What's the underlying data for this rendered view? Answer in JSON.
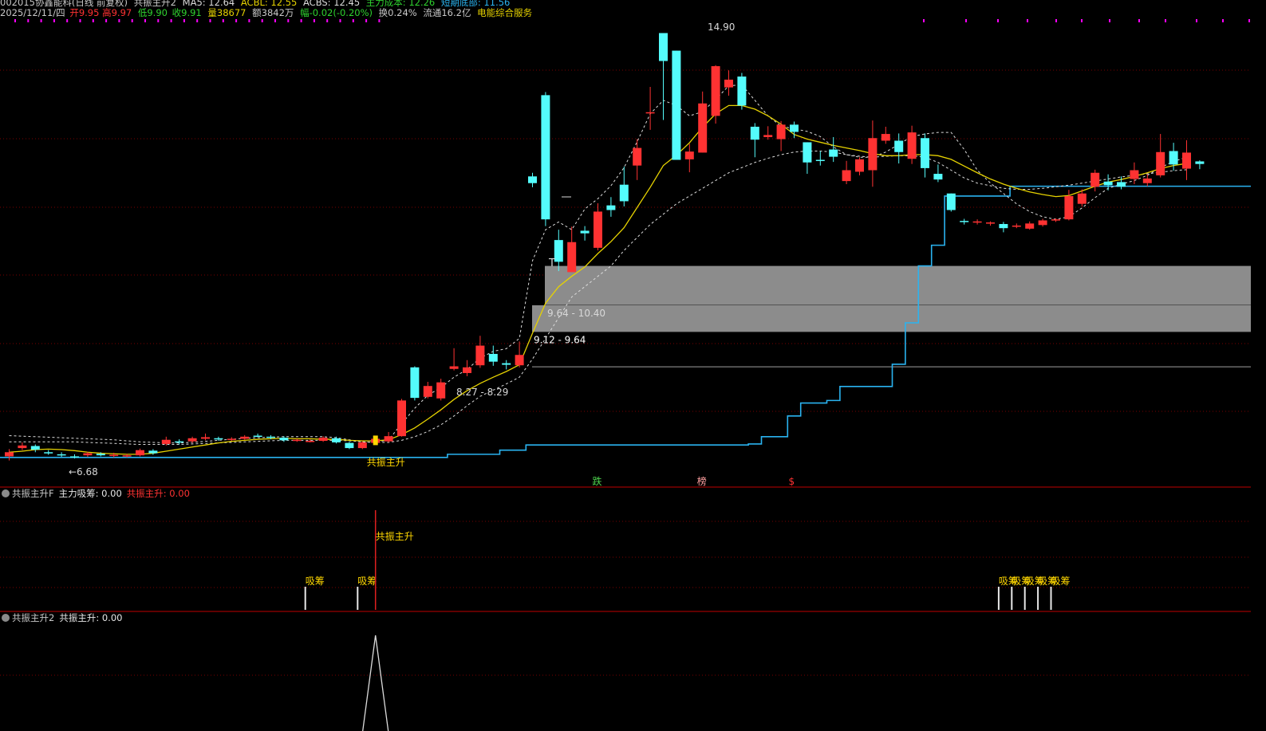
{
  "header": {
    "code_name": "002015协鑫能科(日线 前复权)",
    "indicator_name": "共振主升2",
    "ma5": "MA5: 12.64",
    "acbl": "ACBL: 12.55",
    "acbs": "ACBS: 12.45",
    "main_cost": "主力成本: 12.26",
    "short_bottom": "短期底部: 11.56",
    "date": "2025/12/11/四",
    "open": "开9.95",
    "high": "高9.97",
    "low": "低9.90",
    "close": "收9.91",
    "volume": "量38677",
    "amount": "额3842万",
    "change": "幅-0.02(-0.20%)",
    "turnover": "换0.24%",
    "float": "流通16.2亿",
    "sector": "电能综合服务"
  },
  "indicators": [
    {
      "circle_icon": "collapse-icon",
      "name": "共振主升F",
      "label1": "主力吸筹: 0.00",
      "label2": "共振主升: 0.00"
    },
    {
      "circle_icon": "collapse-icon",
      "name": "共振主升2",
      "label1": "共振主升: 0.00"
    }
  ],
  "colors": {
    "up": "#ff3232",
    "down": "#54fcfc",
    "ma_yellow": "#e6d200",
    "dash_white": "#dcdcdc",
    "cost_blue": "#2ab3f0",
    "grid": "#7a0000",
    "zone": "#8c8c8c",
    "signal_yellow": "#ffd700"
  },
  "chart_data": {
    "type": "candlestick",
    "title": "",
    "price_labels": {
      "high": "14.90",
      "low": "←6.68"
    },
    "zones": [
      {
        "low": 9.64,
        "high": 10.4,
        "label": "9.64 - 10.40"
      },
      {
        "low": 9.12,
        "high": 9.64,
        "label": "9.12 - 9.64"
      }
    ],
    "range_labels": [
      {
        "label": "8.27 - 8.29",
        "price": 8.28,
        "index": 35
      }
    ],
    "ref_line": 8.45,
    "y_range": [
      6.45,
      15.2
    ],
    "candles": [
      {
        "o": 6.72,
        "c": 6.8,
        "h": 6.86,
        "l": 6.64
      },
      {
        "o": 6.88,
        "c": 6.93,
        "h": 6.99,
        "l": 6.84
      },
      {
        "o": 6.92,
        "c": 6.85,
        "h": 6.95,
        "l": 6.8
      },
      {
        "o": 6.8,
        "c": 6.79,
        "h": 6.84,
        "l": 6.75
      },
      {
        "o": 6.76,
        "c": 6.74,
        "h": 6.8,
        "l": 6.71
      },
      {
        "o": 6.72,
        "c": 6.7,
        "h": 6.76,
        "l": 6.68
      },
      {
        "o": 6.74,
        "c": 6.78,
        "h": 6.81,
        "l": 6.71
      },
      {
        "o": 6.77,
        "c": 6.74,
        "h": 6.8,
        "l": 6.72
      },
      {
        "o": 6.75,
        "c": 6.75,
        "h": 6.79,
        "l": 6.7
      },
      {
        "o": 6.73,
        "c": 6.74,
        "h": 6.77,
        "l": 6.7
      },
      {
        "o": 6.74,
        "c": 6.84,
        "h": 6.87,
        "l": 6.72
      },
      {
        "o": 6.83,
        "c": 6.78,
        "h": 6.86,
        "l": 6.75
      },
      {
        "o": 6.96,
        "c": 7.04,
        "h": 7.1,
        "l": 6.93
      },
      {
        "o": 7.01,
        "c": 6.99,
        "h": 7.05,
        "l": 6.95
      },
      {
        "o": 7.01,
        "c": 7.07,
        "h": 7.1,
        "l": 6.98
      },
      {
        "o": 7.06,
        "c": 7.09,
        "h": 7.16,
        "l": 7.03
      },
      {
        "o": 7.07,
        "c": 7.06,
        "h": 7.1,
        "l": 7.02
      },
      {
        "o": 7.05,
        "c": 7.06,
        "h": 7.09,
        "l": 7.02
      },
      {
        "o": 7.06,
        "c": 7.1,
        "h": 7.13,
        "l": 7.04
      },
      {
        "o": 7.12,
        "c": 7.11,
        "h": 7.16,
        "l": 7.09
      },
      {
        "o": 7.1,
        "c": 7.09,
        "h": 7.13,
        "l": 7.05
      },
      {
        "o": 7.08,
        "c": 7.03,
        "h": 7.11,
        "l": 7.0
      },
      {
        "o": 7.02,
        "c": 7.04,
        "h": 7.06,
        "l": 7.0
      },
      {
        "o": 7.02,
        "c": 7.02,
        "h": 7.05,
        "l": 6.99
      },
      {
        "o": 7.02,
        "c": 7.08,
        "h": 7.11,
        "l": 7.0
      },
      {
        "o": 7.07,
        "c": 6.99,
        "h": 7.1,
        "l": 6.97
      },
      {
        "o": 6.98,
        "c": 6.88,
        "h": 7.0,
        "l": 6.86
      },
      {
        "o": 6.88,
        "c": 6.99,
        "h": 7.01,
        "l": 6.86
      },
      {
        "o": 6.98,
        "c": 7.06,
        "h": 7.09,
        "l": 6.95
      },
      {
        "o": 7.01,
        "c": 7.11,
        "h": 7.19,
        "l": 6.99
      },
      {
        "o": 7.11,
        "c": 7.8,
        "h": 7.83,
        "l": 7.1
      },
      {
        "o": 8.44,
        "c": 7.85,
        "h": 8.46,
        "l": 7.8
      },
      {
        "o": 7.87,
        "c": 8.08,
        "h": 8.16,
        "l": 7.84
      },
      {
        "o": 7.84,
        "c": 8.15,
        "h": 8.22,
        "l": 7.8
      },
      {
        "o": 8.41,
        "c": 8.46,
        "h": 8.81,
        "l": 8.38
      },
      {
        "o": 8.33,
        "c": 8.44,
        "h": 8.58,
        "l": 8.27
      },
      {
        "o": 8.48,
        "c": 8.86,
        "h": 9.05,
        "l": 8.43
      },
      {
        "o": 8.7,
        "c": 8.55,
        "h": 8.86,
        "l": 8.47
      },
      {
        "o": 8.52,
        "c": 8.49,
        "h": 8.58,
        "l": 8.4
      },
      {
        "o": 8.48,
        "c": 8.68,
        "h": 8.94,
        "l": 8.44
      },
      {
        "o": 12.13,
        "c": 12.0,
        "h": 12.2,
        "l": 11.92
      },
      {
        "o": 13.7,
        "c": 11.3,
        "h": 13.76,
        "l": 11.17
      },
      {
        "o": 10.9,
        "c": 10.48,
        "h": 11.1,
        "l": 10.3
      },
      {
        "o": 10.28,
        "c": 10.86,
        "h": 11.16,
        "l": 10.28
      },
      {
        "o": 11.08,
        "c": 11.03,
        "h": 11.17,
        "l": 10.89
      },
      {
        "o": 10.75,
        "c": 11.45,
        "h": 11.61,
        "l": 10.7
      },
      {
        "o": 11.57,
        "c": 11.48,
        "h": 11.73,
        "l": 11.35
      },
      {
        "o": 11.97,
        "c": 11.65,
        "h": 12.32,
        "l": 11.55
      },
      {
        "o": 12.34,
        "c": 12.68,
        "h": 12.85,
        "l": 12.06
      },
      {
        "o": 13.37,
        "c": 13.37,
        "h": 13.86,
        "l": 13.03
      },
      {
        "o": 14.9,
        "c": 14.36,
        "h": 14.9,
        "l": 13.22
      },
      {
        "o": 14.56,
        "c": 12.45,
        "h": 14.56,
        "l": 12.45
      },
      {
        "o": 12.46,
        "c": 12.61,
        "h": 12.76,
        "l": 12.21
      },
      {
        "o": 12.59,
        "c": 13.54,
        "h": 13.77,
        "l": 12.59
      },
      {
        "o": 13.3,
        "c": 14.26,
        "h": 14.28,
        "l": 13.15
      },
      {
        "o": 13.85,
        "c": 14.0,
        "h": 14.18,
        "l": 13.69
      },
      {
        "o": 14.06,
        "c": 13.5,
        "h": 14.13,
        "l": 13.42
      },
      {
        "o": 13.09,
        "c": 12.84,
        "h": 13.16,
        "l": 12.5
      },
      {
        "o": 12.89,
        "c": 12.93,
        "h": 13.1,
        "l": 12.84
      },
      {
        "o": 12.85,
        "c": 13.13,
        "h": 13.2,
        "l": 12.62
      },
      {
        "o": 13.13,
        "c": 12.99,
        "h": 13.19,
        "l": 12.87
      },
      {
        "o": 12.79,
        "c": 12.4,
        "h": 12.79,
        "l": 12.18
      },
      {
        "o": 12.45,
        "c": 12.43,
        "h": 12.62,
        "l": 12.34
      },
      {
        "o": 12.65,
        "c": 12.51,
        "h": 12.89,
        "l": 12.41
      },
      {
        "o": 12.04,
        "c": 12.25,
        "h": 12.43,
        "l": 11.98
      },
      {
        "o": 12.22,
        "c": 12.46,
        "h": 12.5,
        "l": 12.15
      },
      {
        "o": 12.25,
        "c": 12.87,
        "h": 13.21,
        "l": 11.93
      },
      {
        "o": 12.82,
        "c": 12.95,
        "h": 13.09,
        "l": 12.76
      },
      {
        "o": 12.82,
        "c": 12.6,
        "h": 12.96,
        "l": 12.38
      },
      {
        "o": 12.47,
        "c": 12.98,
        "h": 13.11,
        "l": 12.37
      },
      {
        "o": 12.87,
        "c": 12.29,
        "h": 12.96,
        "l": 12.11
      },
      {
        "o": 12.18,
        "c": 12.07,
        "h": 12.36,
        "l": 12.02
      },
      {
        "o": 11.8,
        "c": 11.48,
        "h": 11.8,
        "l": 11.45
      },
      {
        "o": 11.27,
        "c": 11.26,
        "h": 11.31,
        "l": 11.2
      },
      {
        "o": 11.25,
        "c": 11.26,
        "h": 11.3,
        "l": 11.2
      },
      {
        "o": 11.22,
        "c": 11.24,
        "h": 11.26,
        "l": 11.18
      },
      {
        "o": 11.21,
        "c": 11.13,
        "h": 11.25,
        "l": 11.05
      },
      {
        "o": 11.18,
        "c": 11.18,
        "h": 11.22,
        "l": 11.13
      },
      {
        "o": 11.12,
        "c": 11.22,
        "h": 11.26,
        "l": 11.1
      },
      {
        "o": 11.19,
        "c": 11.28,
        "h": 11.31,
        "l": 11.16
      },
      {
        "o": 11.28,
        "c": 11.3,
        "h": 11.32,
        "l": 11.25
      },
      {
        "o": 11.3,
        "c": 11.75,
        "h": 11.87,
        "l": 11.28
      },
      {
        "o": 11.6,
        "c": 11.8,
        "h": 11.88,
        "l": 11.55
      },
      {
        "o": 11.93,
        "c": 12.2,
        "h": 12.26,
        "l": 11.84
      },
      {
        "o": 12.03,
        "c": 11.96,
        "h": 12.17,
        "l": 11.86
      },
      {
        "o": 12.02,
        "c": 11.93,
        "h": 12.13,
        "l": 11.88
      },
      {
        "o": 12.08,
        "c": 12.25,
        "h": 12.4,
        "l": 11.98
      },
      {
        "o": 12.0,
        "c": 12.09,
        "h": 12.17,
        "l": 11.94
      },
      {
        "o": 12.15,
        "c": 12.6,
        "h": 12.95,
        "l": 12.11
      },
      {
        "o": 12.62,
        "c": 12.36,
        "h": 12.78,
        "l": 12.24
      },
      {
        "o": 12.28,
        "c": 12.59,
        "h": 12.83,
        "l": 12.06
      },
      {
        "o": 12.42,
        "c": 12.37,
        "h": 12.44,
        "l": 12.27
      }
    ],
    "ma_yellow": [
      6.8,
      6.82,
      6.85,
      6.86,
      6.85,
      6.83,
      6.8,
      6.78,
      6.77,
      6.76,
      6.76,
      6.78,
      6.82,
      6.86,
      6.9,
      6.94,
      6.98,
      7.01,
      7.03,
      7.05,
      7.06,
      7.07,
      7.06,
      7.06,
      7.05,
      7.05,
      7.03,
      7.02,
      7.02,
      7.04,
      7.14,
      7.27,
      7.44,
      7.62,
      7.82,
      7.99,
      8.13,
      8.25,
      8.36,
      8.49,
      9.1,
      9.68,
      10.0,
      10.2,
      10.38,
      10.64,
      10.87,
      11.14,
      11.53,
      11.92,
      12.34,
      12.54,
      12.78,
      13.08,
      13.34,
      13.5,
      13.5,
      13.43,
      13.3,
      13.14,
      12.94,
      12.85,
      12.79,
      12.73,
      12.68,
      12.63,
      12.57,
      12.53,
      12.53,
      12.55,
      12.55,
      12.53,
      12.46,
      12.33,
      12.2,
      12.08,
      11.98,
      11.9,
      11.83,
      11.78,
      11.74,
      11.76,
      11.85,
      11.94,
      12.02,
      12.07,
      12.13,
      12.2,
      12.28,
      12.34,
      12.38
    ],
    "ma_dashed": [
      7.12,
      7.11,
      7.1,
      7.09,
      7.08,
      7.07,
      7.06,
      7.05,
      7.04,
      7.02,
      7.0,
      6.99,
      6.98,
      6.98,
      6.99,
      7.01,
      7.03,
      7.05,
      7.07,
      7.08,
      7.09,
      7.1,
      7.1,
      7.1,
      7.1,
      7.08,
      7.04,
      7.0,
      6.99,
      7.04,
      7.35,
      7.65,
      7.9,
      8.05,
      8.25,
      8.4,
      8.62,
      8.75,
      8.8,
      9.0,
      10.5,
      11.1,
      11.25,
      11.1,
      11.5,
      11.7,
      11.95,
      12.3,
      12.8,
      13.34,
      13.6,
      13.5,
      13.3,
      13.38,
      13.62,
      13.88,
      13.9,
      13.6,
      13.3,
      13.1,
      13.05,
      13.0,
      12.9,
      12.7,
      12.55,
      12.5,
      12.5,
      12.6,
      12.75,
      12.9,
      12.95,
      12.98,
      12.98,
      12.65,
      12.25,
      12.0,
      11.8,
      11.6,
      11.45,
      11.35,
      11.3,
      11.35,
      11.52,
      11.72,
      11.9,
      11.98,
      12.05,
      12.15,
      12.3,
      12.42,
      12.5
    ],
    "ma_dashed2": [
      7.0,
      7.0,
      7.0,
      7.0,
      7.0,
      7.0,
      6.99,
      6.98,
      6.97,
      6.96,
      6.95,
      6.95,
      6.95,
      6.95,
      6.96,
      6.97,
      6.98,
      6.99,
      7.0,
      7.01,
      7.02,
      7.03,
      7.03,
      7.03,
      7.03,
      7.03,
      7.02,
      7.0,
      6.99,
      6.99,
      7.03,
      7.1,
      7.2,
      7.33,
      7.5,
      7.7,
      7.88,
      8.0,
      8.12,
      8.25,
      8.6,
      9.0,
      9.4,
      9.8,
      10.0,
      10.2,
      10.4,
      10.7,
      10.95,
      11.2,
      11.4,
      11.6,
      11.75,
      11.9,
      12.05,
      12.2,
      12.3,
      12.4,
      12.48,
      12.55,
      12.6,
      12.62,
      12.62,
      12.6,
      12.55,
      12.52,
      12.5,
      12.52,
      12.53,
      12.53,
      12.5,
      12.4,
      12.25,
      12.1,
      12.0,
      11.95,
      11.9,
      11.88,
      11.88,
      11.9,
      11.93,
      11.96,
      12.0,
      12.04,
      12.08,
      12.12,
      12.15,
      12.18,
      12.21,
      12.24,
      12.26
    ],
    "cost_line": [
      6.7,
      6.7,
      6.7,
      6.7,
      6.7,
      6.7,
      6.7,
      6.7,
      6.7,
      6.7,
      6.7,
      6.7,
      6.7,
      6.7,
      6.7,
      6.7,
      6.7,
      6.7,
      6.7,
      6.7,
      6.7,
      6.7,
      6.7,
      6.7,
      6.7,
      6.7,
      6.7,
      6.7,
      6.7,
      6.7,
      6.7,
      6.7,
      6.7,
      6.7,
      6.76,
      6.76,
      6.76,
      6.76,
      6.84,
      6.84,
      6.94,
      6.94,
      6.94,
      6.94,
      6.94,
      6.94,
      6.94,
      6.94,
      6.94,
      6.94,
      6.94,
      6.94,
      6.94,
      6.94,
      6.94,
      6.94,
      6.94,
      6.96,
      7.1,
      7.1,
      7.5,
      7.75,
      7.75,
      7.8,
      8.07,
      8.07,
      8.07,
      8.07,
      8.5,
      9.3,
      10.4,
      10.8,
      11.75,
      11.75,
      11.75,
      11.75,
      11.75,
      11.94,
      11.94,
      11.94,
      11.94,
      11.94,
      11.94,
      11.94,
      11.94,
      11.94,
      11.94,
      11.94,
      11.94,
      11.94,
      11.94
    ],
    "signals": [
      {
        "index": 28,
        "label": "共振主升"
      }
    ],
    "markers": [
      {
        "index": 45,
        "label": "跌",
        "color": "#4dd24d"
      },
      {
        "index": 53,
        "label": "榜",
        "color": "#ffa0a0"
      },
      {
        "index": 60,
        "label": "$",
        "color": "#ff3232"
      }
    ],
    "sub1": {
      "absorb": [
        {
          "index": 23,
          "label": "吸筹"
        },
        {
          "index": 27,
          "label": "吸筹"
        },
        {
          "index": 76,
          "label": "吸筹"
        },
        {
          "index": 77,
          "label": "吸筹"
        },
        {
          "index": 78,
          "label": "吸筹"
        },
        {
          "index": 79,
          "label": "吸筹"
        },
        {
          "index": 80,
          "label": "吸筹"
        }
      ],
      "resonance": [
        {
          "index": 28,
          "label": "共振主升"
        }
      ]
    },
    "sub2": {
      "peak_index": 28,
      "value": 1
    }
  }
}
